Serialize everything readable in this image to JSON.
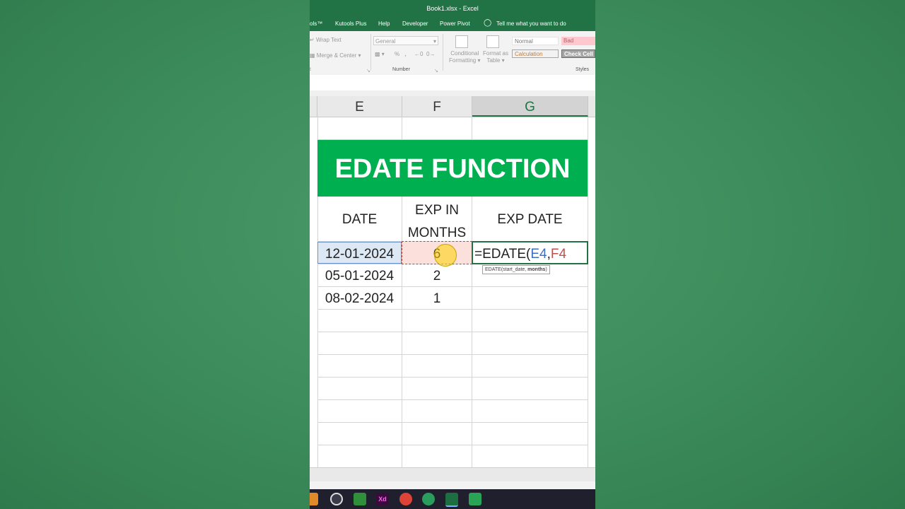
{
  "window": {
    "title": "Book1.xlsx  -  Excel"
  },
  "tabs": [
    "ols™",
    "Kutools Plus",
    "Help",
    "Developer",
    "Power Pivot",
    "Tell me what you want to do"
  ],
  "ribbon": {
    "wrap_text": "Wrap Text",
    "merge_center": "Merge & Center",
    "alignment_fragment": "t",
    "number_format": "General",
    "number_group": "Number",
    "percent_symbol": "%",
    "comma_symbol": ",",
    "conditional_formatting": [
      "Conditional",
      "Formatting"
    ],
    "format_as_table": [
      "Format as",
      "Table"
    ],
    "styles": {
      "normal": "Normal",
      "bad": "Bad",
      "calculation": "Calculation",
      "check_cell": "Check Cell"
    },
    "styles_group": "Styles"
  },
  "columns": [
    "E",
    "F",
    "G"
  ],
  "banner": "EDATE FUNCTION",
  "headers": {
    "date": "DATE",
    "exp_in": "EXP IN",
    "months": "MONTHS",
    "exp_date": "EXP DATE"
  },
  "rows": [
    {
      "date": "12-01-2024",
      "months": "6"
    },
    {
      "date": "05-01-2024",
      "months": "2"
    },
    {
      "date": "08-02-2024",
      "months": "1"
    }
  ],
  "formula": {
    "prefix": "=EDATE(",
    "ref1": "E4",
    "sep": ",",
    "ref2": "F4"
  },
  "tooltip": {
    "args": "EDATE(start_date, ",
    "bold": "months",
    "close": ")"
  },
  "colors": {
    "excel_green": "#217346",
    "banner_green": "#00b050",
    "background": "#3f8f5e"
  }
}
